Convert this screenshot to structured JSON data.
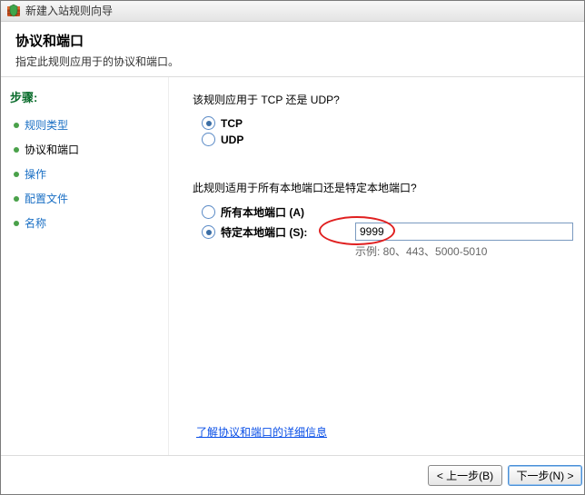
{
  "window": {
    "title": "新建入站规则向导"
  },
  "header": {
    "title": "协议和端口",
    "subtitle": "指定此规则应用于的协议和端口。"
  },
  "sidebar": {
    "heading": "步骤:",
    "items": [
      {
        "label": "规则类型"
      },
      {
        "label": "协议和端口"
      },
      {
        "label": "操作"
      },
      {
        "label": "配置文件"
      },
      {
        "label": "名称"
      }
    ]
  },
  "content": {
    "q1": "该规则应用于 TCP 还是 UDP?",
    "tcp_label": "TCP",
    "udp_label": "UDP",
    "q2": "此规则适用于所有本地端口还是特定本地端口?",
    "all_ports_label": "所有本地端口 (A)",
    "specific_ports_label": "特定本地端口 (S):",
    "port_value": "9999",
    "example": "示例: 80、443、5000-5010",
    "link": "了解协议和端口的详细信息"
  },
  "footer": {
    "back": "< 上一步(B)",
    "next": "下一步(N) >"
  }
}
